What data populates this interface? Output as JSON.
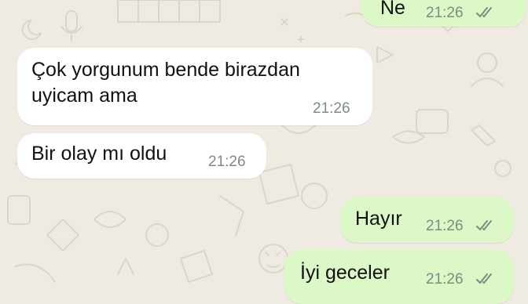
{
  "chat": {
    "messages": [
      {
        "direction": "outgoing",
        "text": "Ne",
        "time": "21:26",
        "status": "read-double-check"
      },
      {
        "direction": "incoming",
        "text": "Çok yorgunum bende birazdan\nuyicam ama",
        "time": "21:26"
      },
      {
        "direction": "incoming",
        "text": "Bir olay mı oldu",
        "time": "21:26"
      },
      {
        "direction": "outgoing",
        "text": "Hayır",
        "time": "21:26",
        "status": "read-double-check"
      },
      {
        "direction": "outgoing",
        "text": "İyi geceler",
        "time": "21:26",
        "status": "read-double-check"
      }
    ]
  },
  "colors": {
    "wallpaper": "#efeae2",
    "incoming_bubble": "#ffffff",
    "outgoing_bubble": "#dcf8c6",
    "timestamp": "#7f8a82"
  }
}
